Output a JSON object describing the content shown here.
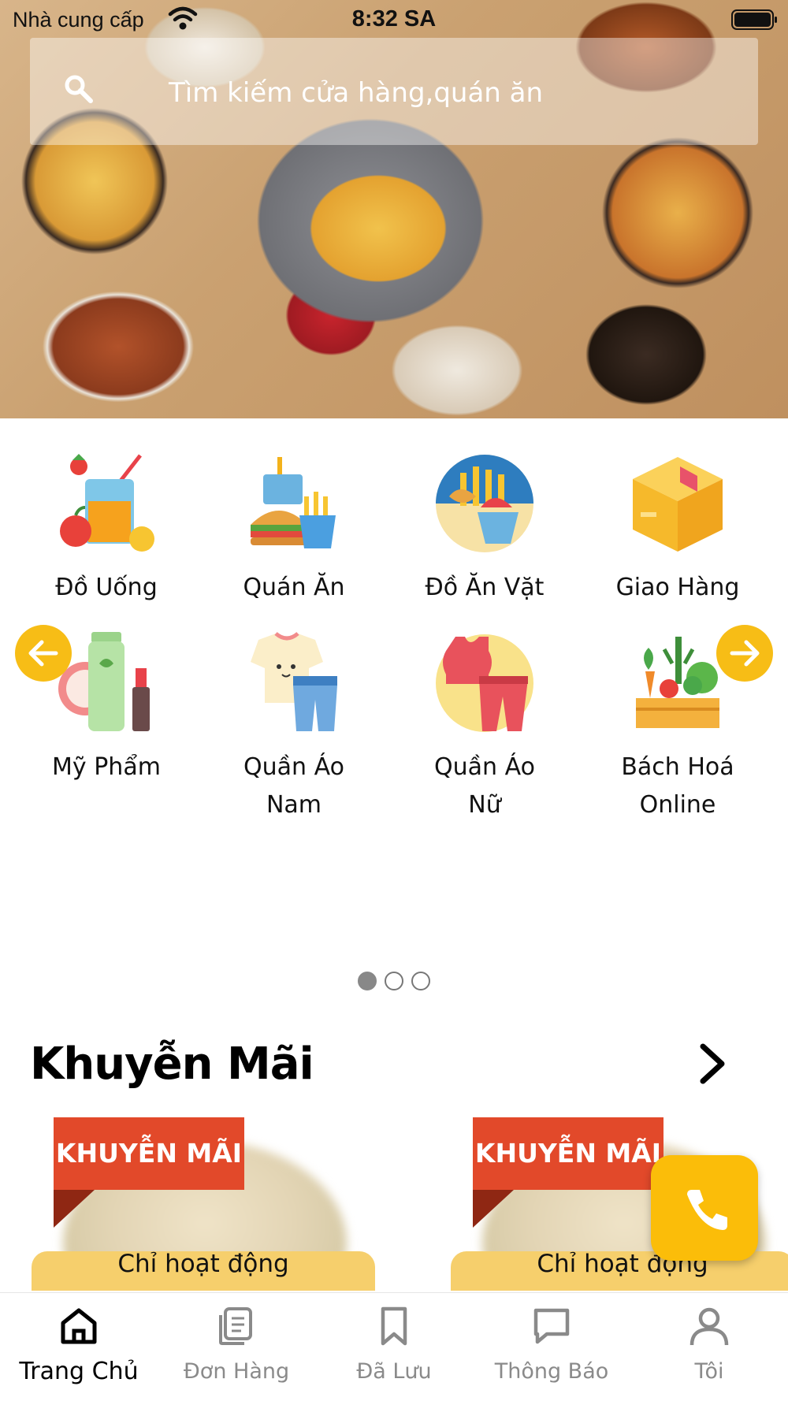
{
  "status_bar": {
    "carrier": "Nhà cung cấp",
    "time": "8:32 SA"
  },
  "search": {
    "placeholder": "Tìm kiếm cửa hàng,quán ăn"
  },
  "categories": [
    {
      "label": "Đồ Uống",
      "icon": "drink-icon"
    },
    {
      "label": "Quán Ăn",
      "icon": "fast-food-icon"
    },
    {
      "label": "Đồ Ăn Vặt",
      "icon": "snack-icon"
    },
    {
      "label": "Giao Hàng",
      "icon": "box-icon"
    },
    {
      "label": "Mỹ Phẩm",
      "icon": "cosmetics-icon"
    },
    {
      "label_line1": "Quần Áo",
      "label_line2": "Nam",
      "icon": "mens-clothes-icon"
    },
    {
      "label_line1": "Quần Áo",
      "label_line2": "Nữ",
      "icon": "womens-clothes-icon"
    },
    {
      "label_line1": "Bách Hoá",
      "label_line2": "Online",
      "icon": "grocery-icon"
    }
  ],
  "pager": {
    "count": 3,
    "active": 0
  },
  "promotions": {
    "title": "Khuyễn Mãi",
    "cards": [
      {
        "tag": "KHUYỄN MÃI",
        "text": "Chỉ hoạt động"
      },
      {
        "tag": "KHUYỄN MÃI",
        "text": "Chỉ hoạt động"
      }
    ]
  },
  "colors": {
    "accent": "#f7bd16",
    "promo_tag": "#e2492a",
    "call_button": "#fbbd09"
  },
  "bottom_nav": [
    {
      "label": "Trang Chủ",
      "icon": "home-icon",
      "active": true
    },
    {
      "label": "Đơn Hàng",
      "icon": "orders-icon",
      "active": false
    },
    {
      "label": "Đã Lưu",
      "icon": "bookmark-icon",
      "active": false
    },
    {
      "label": "Thông Báo",
      "icon": "chat-bubble-icon",
      "active": false
    },
    {
      "label": "Tôi",
      "icon": "user-icon",
      "active": false
    }
  ]
}
